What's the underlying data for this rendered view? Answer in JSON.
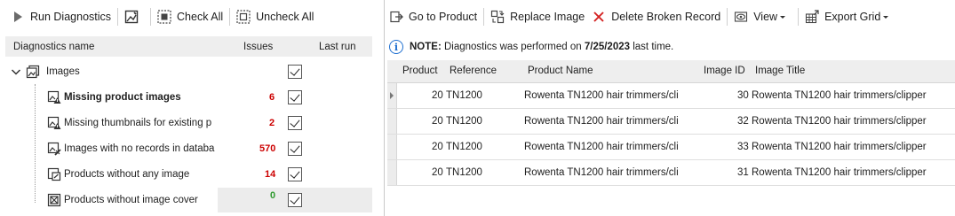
{
  "left_toolbar": {
    "run_label": "Run Diagnostics",
    "check_all_label": "Check All",
    "uncheck_all_label": "Uncheck All"
  },
  "tree": {
    "headers": {
      "name": "Diagnostics name",
      "issues": "Issues",
      "last_run": "Last run"
    },
    "root": {
      "label": "Images",
      "icon": "images-icon"
    },
    "items": [
      {
        "label": "Missing product images",
        "issues": "6",
        "issues_color": "#cc0000",
        "bold": true,
        "icon": "image-warning-icon"
      },
      {
        "label": "Missing thumbnails for existing p",
        "issues": "2",
        "issues_color": "#cc0000",
        "bold": false,
        "icon": "image-warning-icon"
      },
      {
        "label": "Images with no records in databa",
        "issues": "570",
        "issues_color": "#cc0000",
        "bold": false,
        "icon": "image-unlinked-icon"
      },
      {
        "label": "Products without any image",
        "issues": "14",
        "issues_color": "#cc0000",
        "bold": false,
        "icon": "image-missing-icon"
      },
      {
        "label": "Products without image cover",
        "issues": "0",
        "issues_color": "#2e9a2e",
        "bold": false,
        "icon": "image-cover-icon"
      }
    ]
  },
  "right_toolbar": {
    "go_to_product": "Go to Product",
    "replace_image": "Replace Image",
    "delete_broken": "Delete Broken Record",
    "view": "View",
    "export_grid": "Export Grid"
  },
  "note": {
    "prefix": "NOTE:",
    "text_before_date": " Diagnostics was performed on ",
    "date": "7/25/2023",
    "text_after_date": " last time."
  },
  "grid": {
    "columns": [
      "Product",
      "Reference",
      "Product Name",
      "Image ID",
      "Image Title"
    ],
    "rows": [
      {
        "product": "20",
        "reference": "TN1200",
        "name": "Rowenta TN1200 hair trimmers/cli",
        "image_id": "30",
        "title": "Rowenta TN1200 hair trimmers/clipper"
      },
      {
        "product": "20",
        "reference": "TN1200",
        "name": "Rowenta TN1200 hair trimmers/cli",
        "image_id": "32",
        "title": "Rowenta TN1200 hair trimmers/clipper"
      },
      {
        "product": "20",
        "reference": "TN1200",
        "name": "Rowenta TN1200 hair trimmers/cli",
        "image_id": "33",
        "title": "Rowenta TN1200 hair trimmers/clipper"
      },
      {
        "product": "20",
        "reference": "TN1200",
        "name": "Rowenta TN1200 hair trimmers/cli",
        "image_id": "31",
        "title": "Rowenta TN1200 hair trimmers/clipper"
      }
    ]
  }
}
